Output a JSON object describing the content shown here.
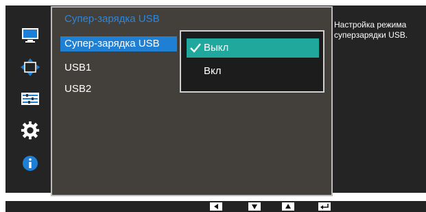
{
  "panel": {
    "title": "Супер-зарядка USB",
    "items": [
      {
        "label": "Супер-зарядка USB"
      },
      {
        "label": "USB1"
      },
      {
        "label": "USB2"
      }
    ]
  },
  "dropdown": {
    "options": [
      {
        "label": "Выкл",
        "selected": true
      },
      {
        "label": "Вкл",
        "selected": false
      }
    ]
  },
  "help": {
    "text": "Настройка режима суперзарядки USB."
  },
  "sidebar": {
    "icons": [
      "monitor-icon",
      "size-position-icon",
      "setup-icon",
      "gear-icon",
      "info-icon"
    ]
  },
  "nav_buttons": [
    "left-arrow-icon",
    "down-arrow-icon",
    "up-arrow-icon",
    "enter-icon"
  ],
  "colors": {
    "highlight_blue": "#1f80d3",
    "selected_teal": "#20a89c",
    "title_blue": "#2f86d8"
  }
}
